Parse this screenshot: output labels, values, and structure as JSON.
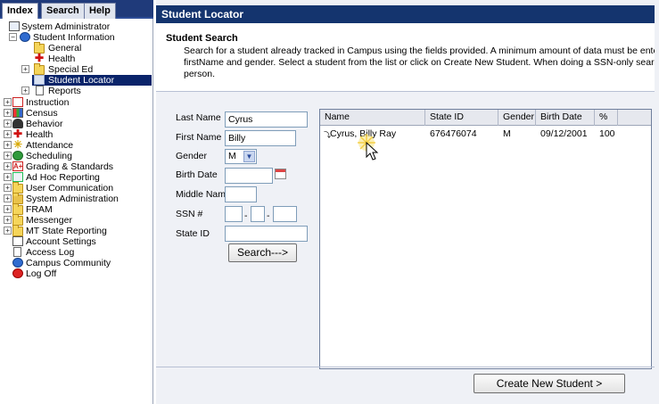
{
  "nav": {
    "tabs": [
      {
        "label": "Index",
        "active": true
      },
      {
        "label": "Search",
        "active": false
      },
      {
        "label": "Help",
        "active": false
      }
    ],
    "tree": [
      {
        "label": "System Administrator",
        "icon": "school-icon",
        "expander": ""
      },
      {
        "label": "Student Information",
        "icon": "student-info-icon",
        "expander": "−"
      },
      {
        "label": "General",
        "icon": "folder-icon",
        "expander": ""
      },
      {
        "label": "Health",
        "icon": "health-icon",
        "expander": ""
      },
      {
        "label": "Special Ed",
        "icon": "folder-icon",
        "expander": "+"
      },
      {
        "label": "Student Locator",
        "icon": "locator-icon",
        "expander": "",
        "selected": true
      },
      {
        "label": "Reports",
        "icon": "document-icon",
        "expander": "+"
      },
      {
        "label": "Instruction",
        "icon": "instruction-icon",
        "expander": "+"
      },
      {
        "label": "Census",
        "icon": "census-icon",
        "expander": "+"
      },
      {
        "label": "Behavior",
        "icon": "behavior-icon",
        "expander": "+"
      },
      {
        "label": "Health",
        "icon": "health-icon",
        "expander": "+"
      },
      {
        "label": "Attendance",
        "icon": "attendance-icon",
        "expander": "+"
      },
      {
        "label": "Scheduling",
        "icon": "scheduling-icon",
        "expander": "+"
      },
      {
        "label": "Grading & Standards",
        "icon": "grading-icon",
        "expander": "+"
      },
      {
        "label": "Ad Hoc Reporting",
        "icon": "adhoc-icon",
        "expander": "+"
      },
      {
        "label": "User Communication",
        "icon": "folder-icon",
        "expander": "+"
      },
      {
        "label": "System Administration",
        "icon": "sysadmin-icon",
        "expander": "+"
      },
      {
        "label": "FRAM",
        "icon": "folder-icon",
        "expander": "+"
      },
      {
        "label": "Messenger",
        "icon": "folder-icon",
        "expander": "+"
      },
      {
        "label": "MT State Reporting",
        "icon": "folder-icon",
        "expander": "+"
      },
      {
        "label": "Account Settings",
        "icon": "account-icon",
        "expander": ""
      },
      {
        "label": "Access Log",
        "icon": "document-icon",
        "expander": ""
      },
      {
        "label": "Campus Community",
        "icon": "community-icon",
        "expander": ""
      },
      {
        "label": "Log Off",
        "icon": "logoff-icon",
        "expander": ""
      }
    ]
  },
  "main": {
    "header": "Student Locator",
    "search_title": "Student Search",
    "search_desc_lines": [
      "Search for a student already tracked in Campus using the fields provided. A minimum amount of data must be entered in o",
      "firstName and gender. Select a student from the list or click on Create New Student. When doing a SSN-only search, the u",
      "person."
    ],
    "form": {
      "last_name_label": "Last Name",
      "last_name_value": "Cyrus",
      "first_name_label": "First Name",
      "first_name_value": "Billy",
      "gender_label": "Gender",
      "gender_value": "M",
      "birth_date_label": "Birth Date",
      "birth_date_value": "",
      "middle_name_label": "Middle Name",
      "middle_name_value": "",
      "ssn_label": "SSN #",
      "ssn_sep": "-",
      "state_id_label": "State ID",
      "state_id_value": "",
      "search_button": "Search--->"
    },
    "results": {
      "headers": [
        "Name",
        "State ID",
        "Gender",
        "Birth Date",
        "%"
      ],
      "rows": [
        {
          "name_marker": "⤵",
          "name": "Cyrus, Billy Ray",
          "state_id": "676476074",
          "gender": "M",
          "birth_date": "09/12/2001",
          "pct": "100"
        }
      ]
    },
    "create_button": "Create New Student >"
  }
}
